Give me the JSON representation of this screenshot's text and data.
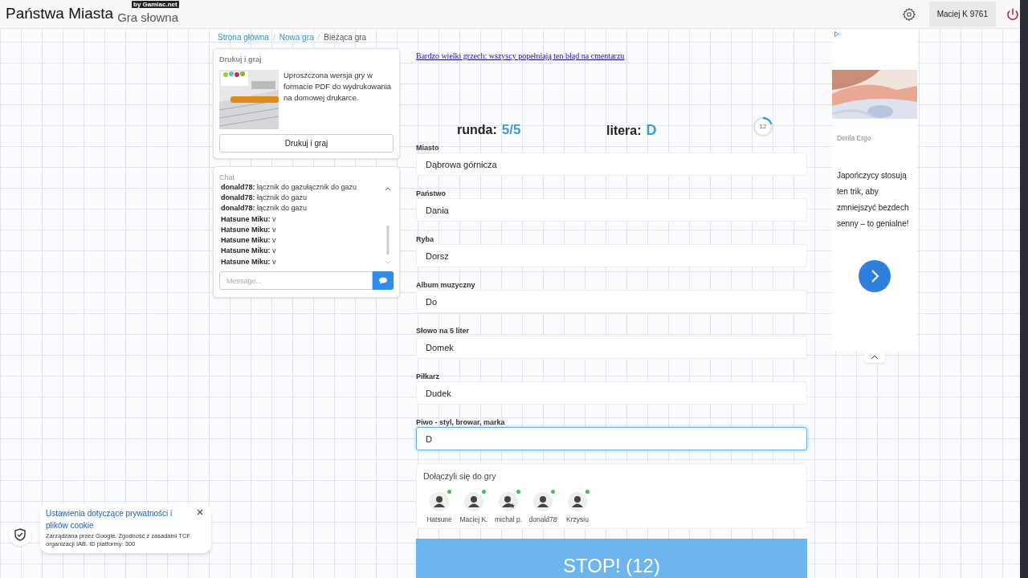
{
  "header": {
    "title": "Państwa Miasta",
    "subtitle": "Gra słowna",
    "badge": "by Gamiac.net",
    "user": "Maciej K 9761"
  },
  "breadcrumbs": {
    "separator": "/",
    "items": [
      {
        "label": "Strona główna",
        "current": false
      },
      {
        "label": "Nowa gra",
        "current": false
      },
      {
        "label": "Bieżąca gra",
        "current": true
      }
    ]
  },
  "print_card": {
    "title": "Drukuj i graj",
    "description": "Uproszczona wersja gry w formacie PDF do wydrukowania na domowej drukarce.",
    "button": "Drukuj i graj"
  },
  "chat": {
    "title": "Chat",
    "messages": [
      {
        "author": "donald78:",
        "text": "łącznik do gazułącznik do gazu"
      },
      {
        "author": "donald78:",
        "text": "łącznik do gazu"
      },
      {
        "author": "donald78:",
        "text": "łącznik do gazu"
      },
      {
        "author": "Hatsune Miku:",
        "text": "v"
      },
      {
        "author": "Hatsune Miku:",
        "text": "v"
      },
      {
        "author": "Hatsune Miku:",
        "text": "v"
      },
      {
        "author": "Hatsune Miku:",
        "text": "v"
      },
      {
        "author": "Hatsune Miku:",
        "text": "v"
      }
    ],
    "placeholder": "Message..."
  },
  "promo_link": "Bardzo wielki grzech: wszyscy popełniają ten błąd na cmentarzu",
  "round": {
    "label": "runda:",
    "value": "5/5"
  },
  "letter": {
    "label": "litera:",
    "value": "D"
  },
  "timer": {
    "text": "12",
    "level": 0.2
  },
  "fields": [
    {
      "label": "Miasto",
      "value": "Dąbrowa górnicza",
      "focused": false
    },
    {
      "label": "Państwo",
      "value": "Dania",
      "focused": false
    },
    {
      "label": "Ryba",
      "value": "Dorsz",
      "focused": false
    },
    {
      "label": "Album muzyczny",
      "value": "Do",
      "focused": false
    },
    {
      "label": "Słowo na 5 liter",
      "value": "Domek",
      "focused": false
    },
    {
      "label": "Piłkarz",
      "value": "Dudek",
      "focused": false
    },
    {
      "label": "Piwo - styl, browar, marka",
      "value": "D",
      "focused": true
    }
  ],
  "players": {
    "title": "Dołączyli się do gry",
    "items": [
      {
        "name": "Hatsune",
        "kind": "user",
        "online": true
      },
      {
        "name": "Maciej K.",
        "kind": "user",
        "online": true
      },
      {
        "name": "michal p.",
        "kind": "admin",
        "online": true
      },
      {
        "name": "donald78",
        "kind": "user",
        "online": true
      },
      {
        "name": "Krzysiu",
        "kind": "user",
        "online": true
      }
    ]
  },
  "stop_button": "STOP! (12)",
  "ad": {
    "sponsor": "Derila Ergo",
    "text": "Japończycy stosują ten trik, aby zmniejszyć bezdech senny – to genialne!"
  },
  "cookie": {
    "title": "Ustawienia dotyczące prywatności i plików cookie",
    "text": "Zarządzana przez Google. Zgodność z zasadami TCF organizacji IAB. ID platformy: 300"
  }
}
